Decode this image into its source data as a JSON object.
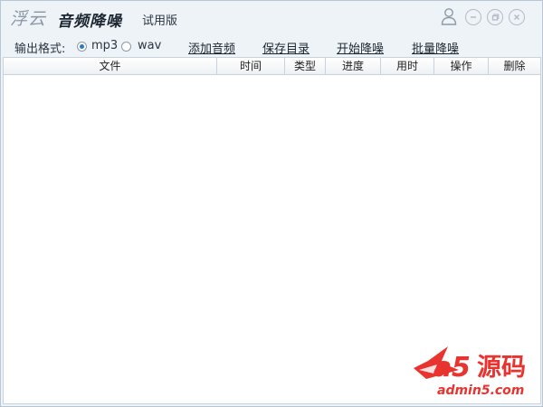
{
  "title": {
    "logo_cloud": "浮云",
    "app_name": "音频降噪",
    "edition": "试用版"
  },
  "window_controls": {
    "user": "user-icon",
    "minimize": "minimize-icon",
    "restore": "restore-icon",
    "close": "close-icon"
  },
  "toolbar": {
    "format_label": "输出格式:",
    "formats": [
      {
        "label": "mp3",
        "selected": true
      },
      {
        "label": "wav",
        "selected": false
      }
    ],
    "add_audio": "添加音频",
    "save_dir": "保存目录",
    "start_denoise": "开始降噪",
    "batch_denoise": "批量降噪"
  },
  "table": {
    "columns": [
      "文件",
      "时间",
      "类型",
      "进度",
      "用时",
      "操作",
      "删除"
    ],
    "rows": []
  },
  "watermark": {
    "brand": "a5源码",
    "url": "admin5.com"
  },
  "colors": {
    "background": "#eef3f8",
    "accent": "#2a78c8",
    "watermark_red": "#e8332f"
  }
}
